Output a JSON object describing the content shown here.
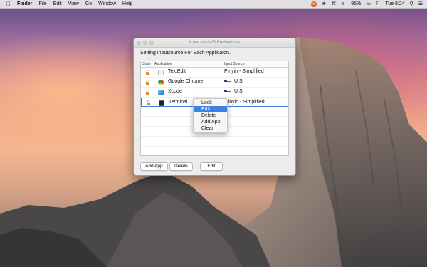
{
  "menubar": {
    "apple_icon": "apple-icon",
    "app_name": "Finder",
    "items": [
      "File",
      "Edit",
      "View",
      "Go",
      "Window",
      "Help"
    ],
    "battery_percent": "95%",
    "time": "Tue 8:24"
  },
  "window": {
    "title": "iLove MarkKB Preferences",
    "heading": "Setting Inputsource For Each Applicaton.",
    "columns": {
      "state": "State",
      "application": "Application",
      "input_source": "Input Source"
    },
    "rows": [
      {
        "app": "TextEdit",
        "source": "Pinyin - Simplified",
        "flag": false,
        "app_icon": "textedit-icon"
      },
      {
        "app": "Google Chrome",
        "source": "U.S.",
        "flag": true,
        "app_icon": "chrome-icon"
      },
      {
        "app": "Xcode",
        "source": "U.S.",
        "flag": true,
        "app_icon": "xcode-icon"
      },
      {
        "app": "Terminal",
        "source": "Pinyin - Simplified",
        "flag": false,
        "app_icon": "terminal-icon",
        "selected": true
      }
    ],
    "buttons": {
      "add_app": "Add App",
      "delete": "Delete",
      "edit": "Edit"
    }
  },
  "context_menu": {
    "items": [
      "Lock",
      "Edit",
      "Delete",
      "Add App",
      "Clear"
    ],
    "highlighted": "Edit"
  },
  "colors": {
    "selection_accent": "#3b82e8",
    "lock_icon": "#e08a2c"
  }
}
